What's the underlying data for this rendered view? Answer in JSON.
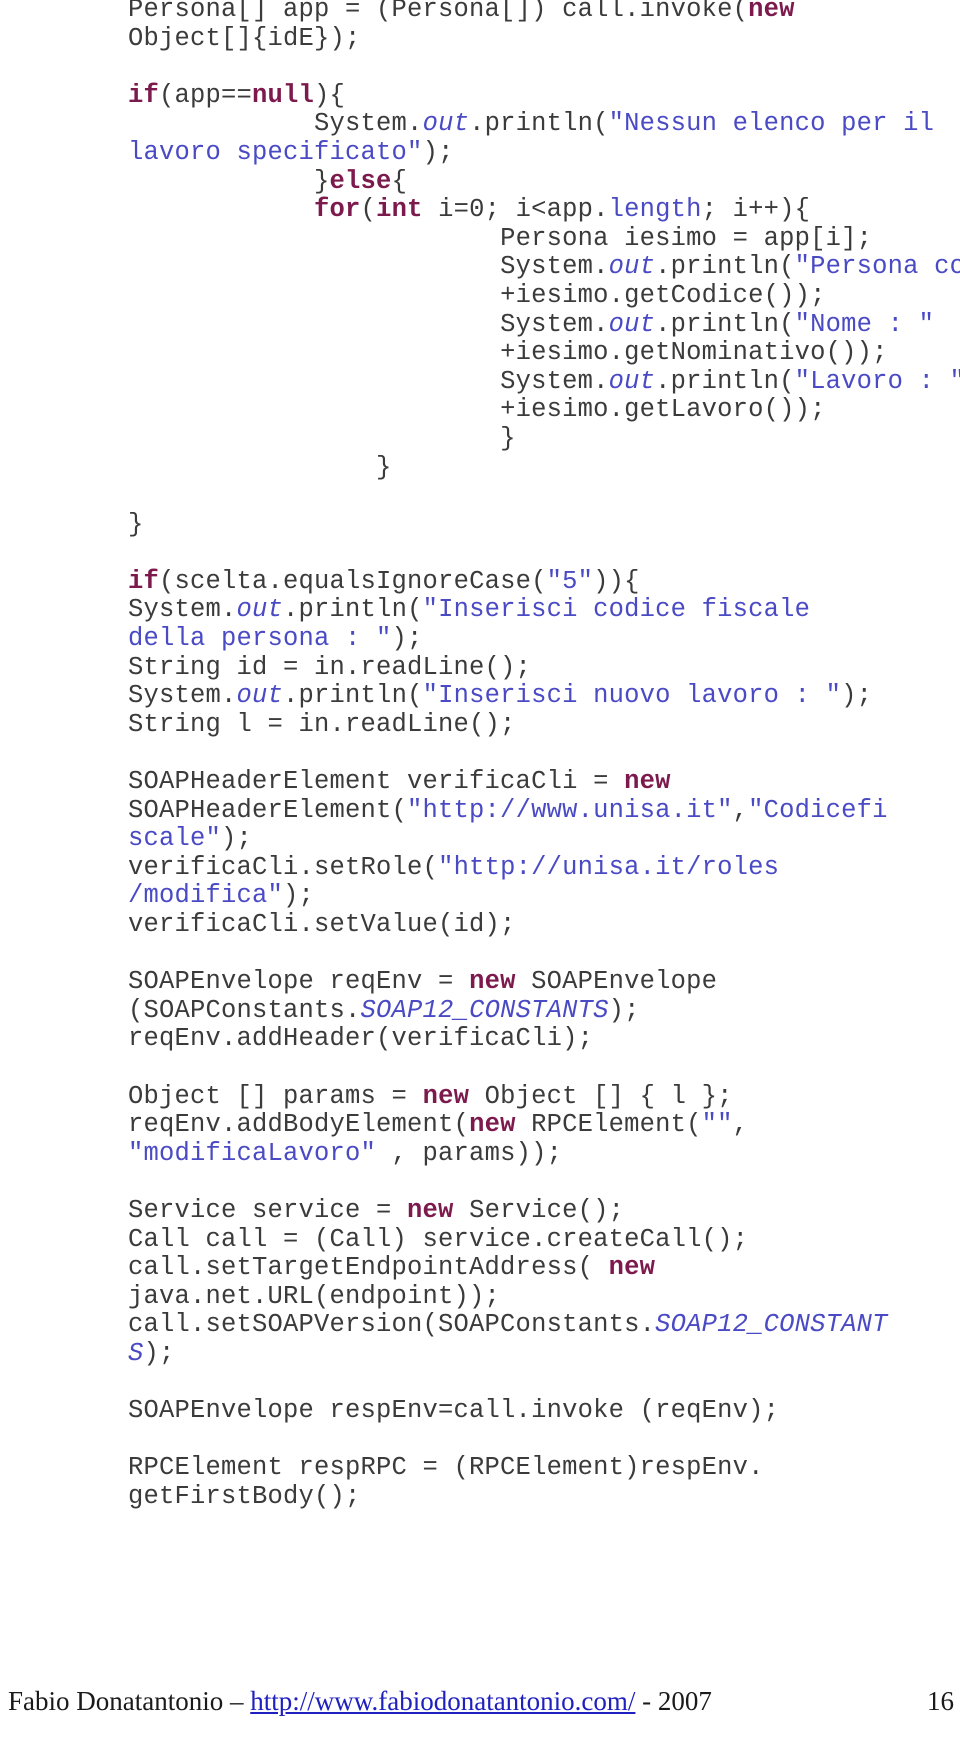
{
  "document": {
    "page_number": "16",
    "language": "java"
  },
  "code": {
    "lines": [
      {
        "indent": 0,
        "tokens": [
          {
            "t": "plain",
            "v": "Persona[] app = (Persona[]) call.invoke("
          },
          {
            "t": "kw",
            "v": "new"
          }
        ]
      },
      {
        "indent": 0,
        "tokens": [
          {
            "t": "plain",
            "v": "Object[]{idE});"
          }
        ]
      },
      {
        "indent": 0,
        "tokens": []
      },
      {
        "indent": 0,
        "tokens": [
          {
            "t": "kw",
            "v": "if"
          },
          {
            "t": "plain",
            "v": "(app=="
          },
          {
            "t": "kw",
            "v": "null"
          },
          {
            "t": "plain",
            "v": "){"
          }
        ]
      },
      {
        "indent": 3,
        "tokens": [
          {
            "t": "plain",
            "v": "System."
          },
          {
            "t": "field",
            "v": "out"
          },
          {
            "t": "plain",
            "v": ".println("
          },
          {
            "t": "str",
            "v": "\"Nessun elenco per il"
          }
        ]
      },
      {
        "indent": 0,
        "tokens": [
          {
            "t": "str",
            "v": "lavoro specificato\""
          },
          {
            "t": "plain",
            "v": ");"
          }
        ]
      },
      {
        "indent": 3,
        "tokens": [
          {
            "t": "plain",
            "v": "}"
          },
          {
            "t": "kw",
            "v": "else"
          },
          {
            "t": "plain",
            "v": "{"
          }
        ]
      },
      {
        "indent": 3,
        "tokens": [
          {
            "t": "kw",
            "v": "for"
          },
          {
            "t": "plain",
            "v": "("
          },
          {
            "t": "kw",
            "v": "int"
          },
          {
            "t": "plain",
            "v": " i=0; i<app."
          },
          {
            "t": "ident",
            "v": "length"
          },
          {
            "t": "plain",
            "v": "; i++){"
          }
        ]
      },
      {
        "indent": 6,
        "tokens": [
          {
            "t": "plain",
            "v": "Persona iesimo = app[i];"
          }
        ]
      },
      {
        "indent": 6,
        "tokens": [
          {
            "t": "plain",
            "v": "System."
          },
          {
            "t": "field",
            "v": "out"
          },
          {
            "t": "plain",
            "v": ".println("
          },
          {
            "t": "str",
            "v": "\"Persona codice : \""
          }
        ]
      },
      {
        "indent": 6,
        "tokens": [
          {
            "t": "plain",
            "v": "+iesimo.getCodice());"
          }
        ]
      },
      {
        "indent": 6,
        "tokens": [
          {
            "t": "plain",
            "v": "System."
          },
          {
            "t": "field",
            "v": "out"
          },
          {
            "t": "plain",
            "v": ".println("
          },
          {
            "t": "str",
            "v": "\"Nome : \""
          }
        ]
      },
      {
        "indent": 6,
        "tokens": [
          {
            "t": "plain",
            "v": "+iesimo.getNominativo());"
          }
        ]
      },
      {
        "indent": 6,
        "tokens": [
          {
            "t": "plain",
            "v": "System."
          },
          {
            "t": "field",
            "v": "out"
          },
          {
            "t": "plain",
            "v": ".println("
          },
          {
            "t": "str",
            "v": "\"Lavoro : \""
          }
        ]
      },
      {
        "indent": 6,
        "tokens": [
          {
            "t": "plain",
            "v": "+iesimo.getLavoro());"
          }
        ]
      },
      {
        "indent": 6,
        "tokens": [
          {
            "t": "plain",
            "v": "}"
          }
        ]
      },
      {
        "indent": 4,
        "tokens": [
          {
            "t": "plain",
            "v": "}"
          }
        ]
      },
      {
        "indent": 0,
        "tokens": []
      },
      {
        "indent": 0,
        "tokens": [
          {
            "t": "plain",
            "v": "}"
          }
        ]
      },
      {
        "indent": 0,
        "tokens": []
      },
      {
        "indent": 0,
        "tokens": [
          {
            "t": "kw",
            "v": "if"
          },
          {
            "t": "plain",
            "v": "(scelta.equalsIgnoreCase("
          },
          {
            "t": "str",
            "v": "\"5\""
          },
          {
            "t": "plain",
            "v": ")){"
          }
        ]
      },
      {
        "indent": 0,
        "tokens": [
          {
            "t": "plain",
            "v": "System."
          },
          {
            "t": "field",
            "v": "out"
          },
          {
            "t": "plain",
            "v": ".println("
          },
          {
            "t": "str",
            "v": "\"Inserisci codice fiscale"
          }
        ]
      },
      {
        "indent": 0,
        "tokens": [
          {
            "t": "str",
            "v": "della persona : \""
          },
          {
            "t": "plain",
            "v": ");"
          }
        ]
      },
      {
        "indent": 0,
        "tokens": [
          {
            "t": "plain",
            "v": "String id = in.readLine();"
          }
        ]
      },
      {
        "indent": 0,
        "tokens": [
          {
            "t": "plain",
            "v": "System."
          },
          {
            "t": "field",
            "v": "out"
          },
          {
            "t": "plain",
            "v": ".println("
          },
          {
            "t": "str",
            "v": "\"Inserisci nuovo lavoro : \""
          },
          {
            "t": "plain",
            "v": ");"
          }
        ]
      },
      {
        "indent": 0,
        "tokens": [
          {
            "t": "plain",
            "v": "String l = in.readLine();"
          }
        ]
      },
      {
        "indent": 0,
        "tokens": []
      },
      {
        "indent": 0,
        "tokens": [
          {
            "t": "plain",
            "v": "SOAPHeaderElement verificaCli = "
          },
          {
            "t": "kw",
            "v": "new"
          }
        ]
      },
      {
        "indent": 0,
        "tokens": [
          {
            "t": "plain",
            "v": "SOAPHeaderElement("
          },
          {
            "t": "str",
            "v": "\"http://www.unisa.it\""
          },
          {
            "t": "plain",
            "v": ","
          },
          {
            "t": "str",
            "v": "\"Codicefi"
          }
        ]
      },
      {
        "indent": 0,
        "tokens": [
          {
            "t": "str",
            "v": "scale\""
          },
          {
            "t": "plain",
            "v": ");"
          }
        ]
      },
      {
        "indent": 0,
        "tokens": [
          {
            "t": "plain",
            "v": "verificaCli.setRole("
          },
          {
            "t": "str",
            "v": "\"http://unisa.it/roles"
          }
        ]
      },
      {
        "indent": 0,
        "tokens": [
          {
            "t": "str",
            "v": "/modifica\""
          },
          {
            "t": "plain",
            "v": ");"
          }
        ]
      },
      {
        "indent": 0,
        "tokens": [
          {
            "t": "plain",
            "v": "verificaCli.setValue(id);"
          }
        ]
      },
      {
        "indent": 0,
        "tokens": []
      },
      {
        "indent": 0,
        "tokens": [
          {
            "t": "plain",
            "v": "SOAPEnvelope reqEnv = "
          },
          {
            "t": "kw",
            "v": "new"
          },
          {
            "t": "plain",
            "v": " SOAPEnvelope"
          }
        ]
      },
      {
        "indent": 0,
        "tokens": [
          {
            "t": "plain",
            "v": "(SOAPConstants."
          },
          {
            "t": "field",
            "v": "SOAP12_CONSTANTS"
          },
          {
            "t": "plain",
            "v": ");"
          }
        ]
      },
      {
        "indent": 0,
        "tokens": [
          {
            "t": "plain",
            "v": "reqEnv.addHeader(verificaCli);"
          }
        ]
      },
      {
        "indent": 0,
        "tokens": []
      },
      {
        "indent": 0,
        "tokens": [
          {
            "t": "plain",
            "v": "Object [] params = "
          },
          {
            "t": "kw",
            "v": "new"
          },
          {
            "t": "plain",
            "v": " Object [] { l };"
          }
        ]
      },
      {
        "indent": 0,
        "tokens": [
          {
            "t": "plain",
            "v": "reqEnv.addBodyElement("
          },
          {
            "t": "kw",
            "v": "new"
          },
          {
            "t": "plain",
            "v": " RPCElement("
          },
          {
            "t": "str",
            "v": "\"\""
          },
          {
            "t": "plain",
            "v": ","
          }
        ]
      },
      {
        "indent": 0,
        "tokens": [
          {
            "t": "str",
            "v": "\"modificaLavoro\""
          },
          {
            "t": "plain",
            "v": " , params));"
          }
        ]
      },
      {
        "indent": 0,
        "tokens": []
      },
      {
        "indent": 0,
        "tokens": [
          {
            "t": "plain",
            "v": "Service service = "
          },
          {
            "t": "kw",
            "v": "new"
          },
          {
            "t": "plain",
            "v": " Service();"
          }
        ]
      },
      {
        "indent": 0,
        "tokens": [
          {
            "t": "plain",
            "v": "Call call = (Call) service.createCall();"
          }
        ]
      },
      {
        "indent": 0,
        "tokens": [
          {
            "t": "plain",
            "v": "call.setTargetEndpointAddress( "
          },
          {
            "t": "kw",
            "v": "new"
          }
        ]
      },
      {
        "indent": 0,
        "tokens": [
          {
            "t": "plain",
            "v": "java.net.URL(endpoint));"
          }
        ]
      },
      {
        "indent": 0,
        "tokens": [
          {
            "t": "plain",
            "v": "call.setSOAPVersion(SOAPConstants."
          },
          {
            "t": "field",
            "v": "SOAP12_CONSTANT"
          }
        ]
      },
      {
        "indent": 0,
        "tokens": [
          {
            "t": "field",
            "v": "S"
          },
          {
            "t": "plain",
            "v": ");"
          }
        ]
      },
      {
        "indent": 0,
        "tokens": []
      },
      {
        "indent": 0,
        "tokens": [
          {
            "t": "plain",
            "v": "SOAPEnvelope respEnv=call.invoke (reqEnv);"
          }
        ]
      },
      {
        "indent": 0,
        "tokens": []
      },
      {
        "indent": 0,
        "tokens": [
          {
            "t": "plain",
            "v": "RPCElement respRPC = (RPCElement)respEnv."
          }
        ]
      },
      {
        "indent": 0,
        "tokens": [
          {
            "t": "plain",
            "v": "getFirstBody();"
          }
        ]
      }
    ]
  },
  "footer": {
    "author": "Fabio Donatantonio",
    "separator": " – ",
    "url": "http://www.fabiodonatantonio.com/",
    "year_suffix": " - 2007",
    "page_number": "16"
  },
  "colors": {
    "code_default": "#3b3b3b",
    "keyword": "#7d1a4d",
    "string": "#4a4ac4",
    "field": "#4a4ac4",
    "link": "#2020c0",
    "background": "#ffffff"
  }
}
